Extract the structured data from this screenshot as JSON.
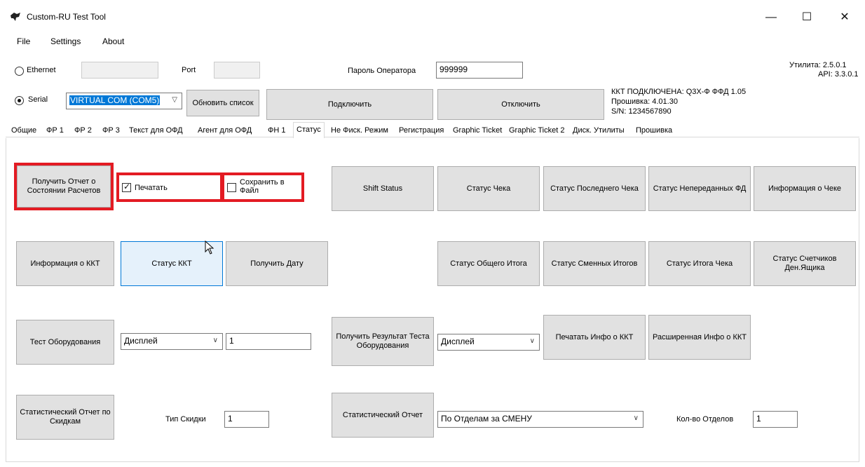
{
  "window": {
    "title": "Custom-RU Test Tool",
    "minimize": "—",
    "maximize": "☐",
    "close": "✕"
  },
  "menu": [
    "File",
    "Settings",
    "About"
  ],
  "connection": {
    "ethernet_label": "Ethernet",
    "ethernet_value": "",
    "port_label": "Port",
    "port_value": "",
    "password_label": "Пароль Оператора",
    "password_value": "999999",
    "serial_label": "Serial",
    "serial_value": "VIRTUAL COM (COM5)",
    "refresh_button": "Обновить список",
    "connect_button": "Подключить",
    "disconnect_button": "Отключить",
    "utility_version": "Утилита: 2.5.0.1",
    "api_version": "API: 3.3.0.1",
    "status_line1": "ККТ ПОДКЛЮЧЕНА: Q3X-Ф  ФФД 1.05",
    "status_line2": "Прошивка: 4.01.30",
    "status_line3": "S/N: 1234567890"
  },
  "tabs": [
    "Общие",
    "ФР 1",
    "ФР 2",
    "ФР 3",
    "Текст для ОФД",
    "Агент для ОФД",
    "ФН 1",
    "Статус",
    "Не Фиск. Режим",
    "Регистрация",
    "Graphic Ticket",
    "Graphic Ticket 2",
    "Диск. Утилиты",
    "Прошивка"
  ],
  "active_tab": "Статус",
  "status_tab": {
    "get_report_button": "Получить Отчет о Состоянии Расчетов",
    "print_checkbox_label": "Печатать",
    "print_checked": true,
    "save_file_checkbox_label": "Сохранить в Файл",
    "save_file_checked": false,
    "shift_status_button": "Shift Status",
    "receipt_status_button": "Статус Чека",
    "last_receipt_status_button": "Статус Последнего Чека",
    "unsent_fd_status_button": "Статус Непереданных ФД",
    "receipt_info_button": "Информация о Чеке",
    "kkt_info_button": "Информация о ККТ",
    "kkt_status_button": "Статус ККТ",
    "get_date_button": "Получить Дату",
    "total_status_button": "Статус Общего Итога",
    "shift_totals_status_button": "Статус Сменных Итогов",
    "receipt_total_status_button": "Статус Итога Чека",
    "cash_drawer_counters_button": "Статус Счетчиков Ден.Ящика",
    "hardware_test_button": "Тест Оборудования",
    "hardware_test_device": "Дисплей",
    "hardware_test_param": "1",
    "get_test_result_button": "Получить Результат Теста Оборудования",
    "test_result_device": "Дисплей",
    "print_kkt_info_button": "Печатать Инфо о ККТ",
    "extended_kkt_info_button": "Расширенная Инфо о ККТ",
    "discount_report_button": "Статистический Отчет по Скидкам",
    "discount_type_label": "Тип Скидки",
    "discount_type_value": "1",
    "stat_report_button": "Статистический Отчет",
    "stat_report_mode": "По Отделам за СМЕНУ",
    "departments_count_label": "Кол-во Отделов",
    "departments_count_value": "1"
  },
  "colors": {
    "highlight_red": "#e31b23",
    "button_face": "#e1e1e1",
    "hover_button": "#e5f1fb",
    "selection_blue": "#0078d7"
  },
  "icons": [
    "app-logo-icon",
    "mouse-cursor-icon",
    "dropdown-caret-icon"
  ]
}
